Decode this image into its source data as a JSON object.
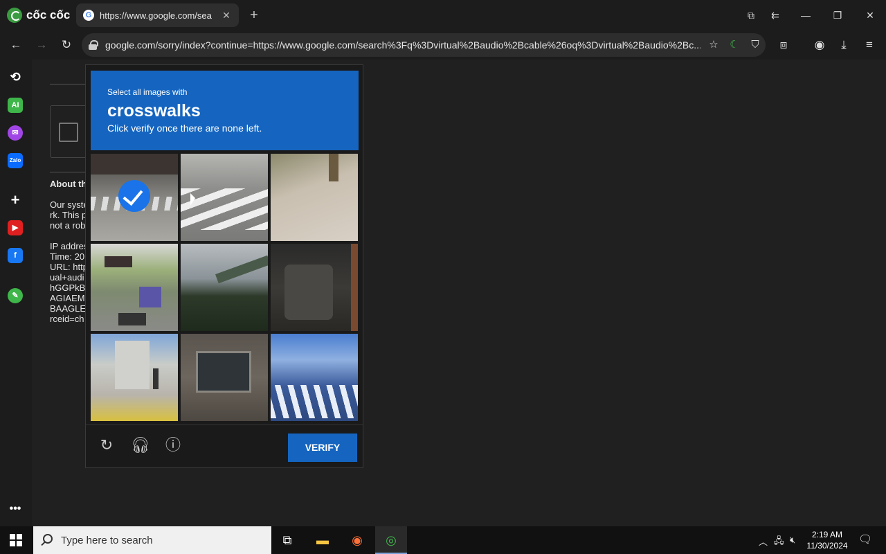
{
  "browser": {
    "brand": "cốc cốc",
    "tab": {
      "title": "https://www.google.com/sea",
      "favicon": "G"
    },
    "url": "google.com/sorry/index?continue=https://www.google.com/search%3Fq%3Dvirtual%2Baudio%2Bcable%26oq%3Dvirtual%2Baudio%2Bc..."
  },
  "background_page": {
    "heading": "About th",
    "para": "Our syste\nrk. This p\nnot a rob",
    "details": "IP addres\nTime: 20\nURL: http\nual+audi\nhGGPkB\nAGIAEM\nBAAGLE\nrceid=ch"
  },
  "captcha": {
    "prompt_small": "Select all images with",
    "target": "crosswalks",
    "instruction": "Click verify once there are none left.",
    "verify_label": "VERIFY",
    "selected_tiles": [
      0
    ]
  },
  "taskbar": {
    "search_placeholder": "Type here to search",
    "time": "2:19 AM",
    "date": "11/30/2024"
  },
  "colors": {
    "accent": "#1565c0",
    "check": "#1a73e8"
  }
}
